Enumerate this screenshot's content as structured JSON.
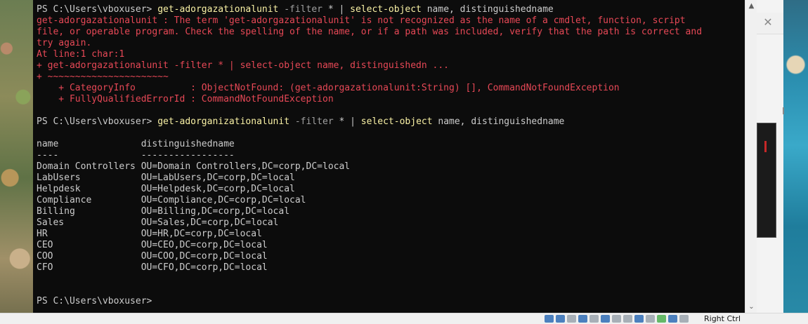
{
  "terminal": {
    "lines": [
      {
        "kind": "prompt",
        "prompt": "PS C:\\Users\\vboxuser> ",
        "cmd1": "get-adorgazationalunit",
        "param": " -filter",
        "rest1": " * | ",
        "cmd2": "select-object",
        "rest2": " name, distinguishedname"
      },
      {
        "kind": "err",
        "text": "get-adorgazationalunit : The term 'get-adorgazationalunit' is not recognized as the name of a cmdlet, function, script"
      },
      {
        "kind": "err",
        "text": "file, or operable program. Check the spelling of the name, or if a path was included, verify that the path is correct and"
      },
      {
        "kind": "err",
        "text": "try again."
      },
      {
        "kind": "err",
        "text": "At line:1 char:1"
      },
      {
        "kind": "err",
        "text": "+ get-adorgazationalunit -filter * | select-object name, distinguishedn ..."
      },
      {
        "kind": "err",
        "text": "+ ~~~~~~~~~~~~~~~~~~~~~~"
      },
      {
        "kind": "err",
        "text": "    + CategoryInfo          : ObjectNotFound: (get-adorgazationalunit:String) [], CommandNotFoundException"
      },
      {
        "kind": "err",
        "text": "    + FullyQualifiedErrorId : CommandNotFoundException"
      },
      {
        "kind": "blank",
        "text": ""
      },
      {
        "kind": "prompt",
        "prompt": "PS C:\\Users\\vboxuser> ",
        "cmd1": "get-adorganizationalunit",
        "param": " -filter",
        "rest1": " * | ",
        "cmd2": "select-object",
        "rest2": " name, distinguishedname"
      },
      {
        "kind": "blank",
        "text": ""
      },
      {
        "kind": "txt",
        "text": "name               distinguishedname"
      },
      {
        "kind": "txt",
        "text": "----               -----------------"
      },
      {
        "kind": "txt",
        "text": "Domain Controllers OU=Domain Controllers,DC=corp,DC=local"
      },
      {
        "kind": "txt",
        "text": "LabUsers           OU=LabUsers,DC=corp,DC=local"
      },
      {
        "kind": "txt",
        "text": "Helpdesk           OU=Helpdesk,DC=corp,DC=local"
      },
      {
        "kind": "txt",
        "text": "Compliance         OU=Compliance,DC=corp,DC=local"
      },
      {
        "kind": "txt",
        "text": "Billing            OU=Billing,DC=corp,DC=local"
      },
      {
        "kind": "txt",
        "text": "Sales              OU=Sales,DC=corp,DC=local"
      },
      {
        "kind": "txt",
        "text": "HR                 OU=HR,DC=corp,DC=local"
      },
      {
        "kind": "txt",
        "text": "CEO                OU=CEO,DC=corp,DC=local"
      },
      {
        "kind": "txt",
        "text": "COO                OU=COO,DC=corp,DC=local"
      },
      {
        "kind": "txt",
        "text": "CFO                OU=CFO,DC=corp,DC=local"
      },
      {
        "kind": "blank",
        "text": ""
      },
      {
        "kind": "blank",
        "text": ""
      },
      {
        "kind": "txt",
        "text": "PS C:\\Users\\vboxuser>"
      }
    ]
  },
  "colors": {
    "background": "#0c0c0c",
    "text": "#cccccc",
    "error": "#e74856",
    "command": "#f9f1a5",
    "parameter": "#a0a0a0"
  },
  "icons": {
    "close": "close-icon",
    "scroll_up": "chevron-up-icon",
    "scroll_down": "chevron-down-icon"
  },
  "statusbar": {
    "host_key_label": "Right Ctrl"
  }
}
